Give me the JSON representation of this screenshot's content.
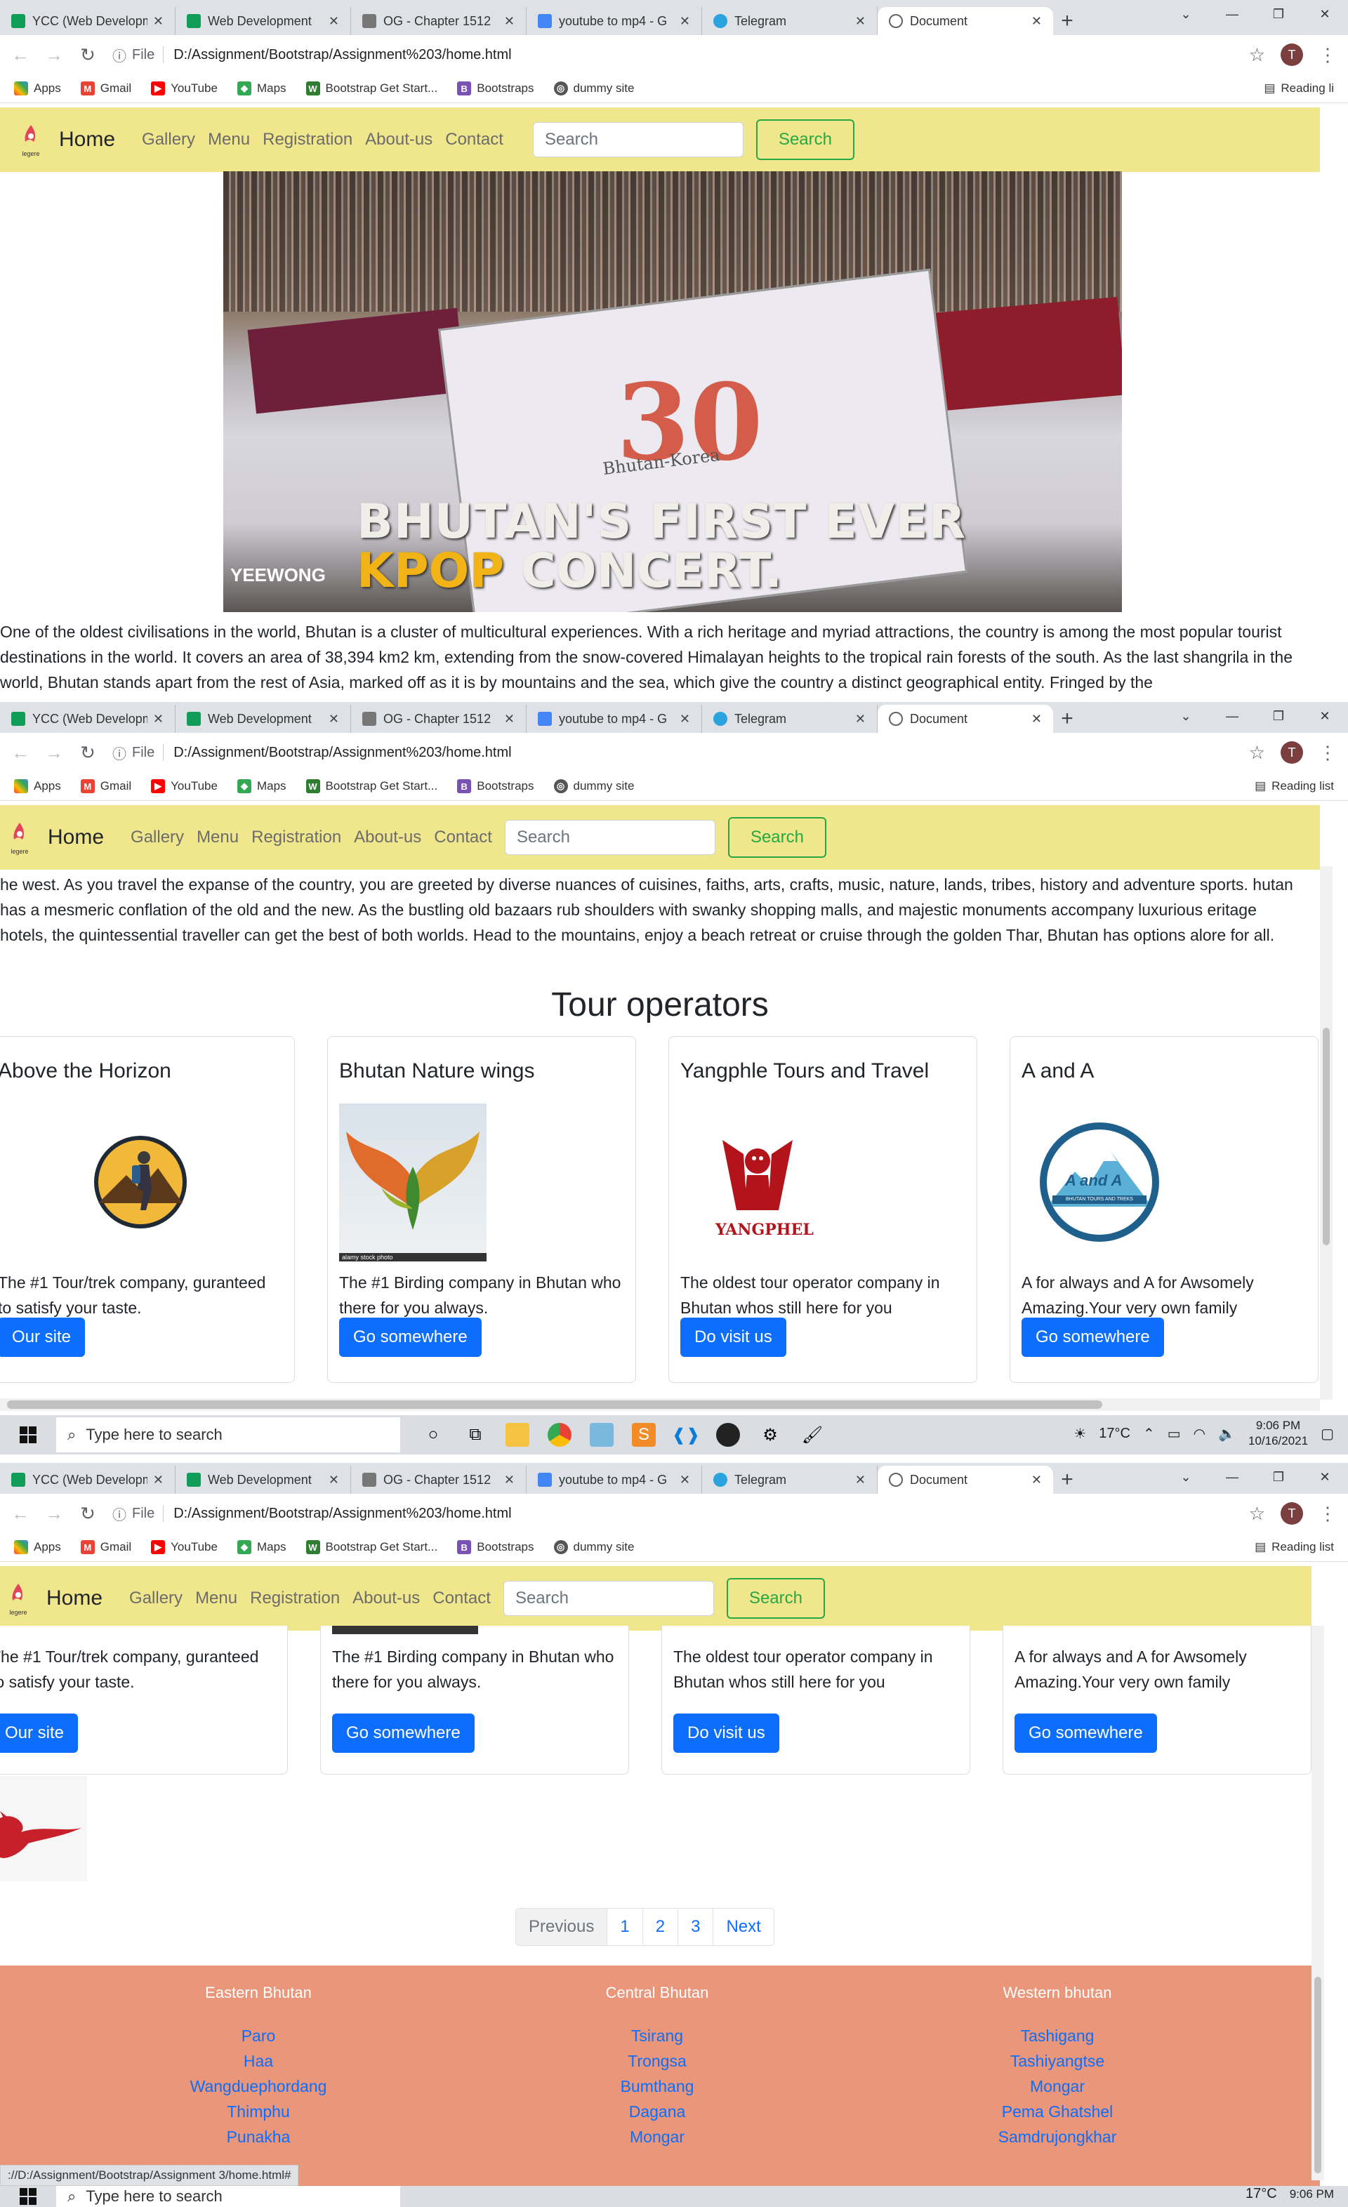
{
  "browser": {
    "tabs": [
      {
        "title": "YCC (Web Developm",
        "icon": "sheets-icon",
        "color": "#0f9d58"
      },
      {
        "title": "Web Development",
        "icon": "sheets-icon",
        "color": "#0f9d58"
      },
      {
        "title": "OG - Chapter 1512",
        "icon": "manga-icon",
        "color": "#555555"
      },
      {
        "title": "youtube to mp4 - G",
        "icon": "google-icon",
        "color": "#4285f4"
      },
      {
        "title": "Telegram",
        "icon": "telegram-icon",
        "color": "#2aa3df"
      },
      {
        "title": "Document",
        "icon": "globe-icon",
        "color": "#5f6368"
      }
    ],
    "address_prefix": "File",
    "address": "D:/Assignment/Bootstrap/Assignment%203/home.html",
    "profile_initial": "T",
    "bookmarks": [
      {
        "label": "Apps",
        "icon": "apps-grid-icon",
        "color": "#ea4335"
      },
      {
        "label": "Gmail",
        "icon": "gmail-icon",
        "color": "#ea4335"
      },
      {
        "label": "YouTube",
        "icon": "youtube-icon",
        "color": "#ff0000"
      },
      {
        "label": "Maps",
        "icon": "maps-icon",
        "color": "#34a853"
      },
      {
        "label": "Bootstrap Get Start...",
        "icon": "w-icon",
        "color": "#2e7d32"
      },
      {
        "label": "Bootstraps",
        "icon": "bootstrap-icon",
        "color": "#7952b3"
      },
      {
        "label": "dummy site",
        "icon": "globe-icon",
        "color": "#555555"
      }
    ],
    "reading_list": "Reading list",
    "reading_list_truncated": "Reading li"
  },
  "navbar": {
    "brand": "Home",
    "logo_text": "legere",
    "links": [
      "Gallery",
      "Menu",
      "Registration",
      "About-us",
      "Contact"
    ],
    "search_placeholder": "Search",
    "search_button": "Search",
    "bg_color": "#f0e68c"
  },
  "hero": {
    "line1": "BHUTAN'S FIRST EVER",
    "line2a": "KPOP",
    "line2b": " CONCERT.",
    "watermark": "YEEWONG",
    "banner_text": "Bhutan-Korea",
    "banner_number": "30"
  },
  "intro": {
    "part1": "One of the oldest civilisations in the world, Bhutan is a cluster of multicultural experiences. With a rich heritage and myriad attractions, the country is among the most popular tourist destinations in the world. It covers an area of 38,394 km2 km, extending from the snow-covered Himalayan heights to the tropical rain forests of the south. As the last shangrila in the world, Bhutan stands apart from the rest of Asia, marked off as it is by mountains and the sea, which give the country a distinct geographical entity. Fringed by the",
    "part2": "he west. As you travel the expanse of the country, you are greeted by diverse nuances of cuisines, faiths, arts, crafts, music, nature, lands, tribes, history and adventure sports. hutan has a mesmeric conflation of the old and the new. As the bustling old bazaars rub shoulders with swanky shopping malls, and majestic monuments accompany luxurious eritage hotels, the quintessential traveller can get the best of both worlds. Head to the mountains, enjoy a beach retreat or cruise through the golden Thar, Bhutan has options alore for all."
  },
  "tour_heading": "Tour operators",
  "cards": [
    {
      "title": "Above the Horizon",
      "text": "The #1 Tour/trek company, guranteed to satisfy your taste.",
      "button": "Our site",
      "image": "hiker-logo"
    },
    {
      "title": "Bhutan Nature wings",
      "text": "The #1 Birding company in Bhutan who there for you always.",
      "button": "Go somewhere",
      "image": "leaf-bird",
      "image_caption": "alamy stock photo"
    },
    {
      "title": "Yangphle Tours and Travel",
      "text": "The oldest tour operator company in Bhutan whos still here for you",
      "button": "Do visit us",
      "image": "yangphel-logo",
      "logo_text": "YANGPHEL"
    },
    {
      "title": "A and A",
      "text": "A for always and A for Awsomely Amazing.Your very own family",
      "button": "Go somewhere",
      "image": "aanda-logo",
      "logo_text": "A and A",
      "logo_sub": "BHUTAN TOURS AND TREKS"
    }
  ],
  "taskbar": {
    "search_placeholder": "Type here to search",
    "temperature": "17°C",
    "time": "9:06 PM",
    "date": "10/16/2021"
  },
  "pagination": {
    "previous": "Previous",
    "pages": [
      "1",
      "2",
      "3"
    ],
    "next": "Next"
  },
  "footer": {
    "bg_color": "#e9967a",
    "columns": [
      {
        "heading": "Eastern Bhutan",
        "links": [
          "Paro",
          "Haa",
          "Wangduephordang",
          "Thimphu",
          "Punakha"
        ]
      },
      {
        "heading": "Central Bhutan",
        "links": [
          "Tsirang",
          "Trongsa",
          "Bumthang",
          "Dagana",
          "Mongar"
        ]
      },
      {
        "heading": "Western bhutan",
        "links": [
          "Tashigang",
          "Tashiyangtse",
          "Mongar",
          "Pema Ghatshel",
          "Samdrujongkhar"
        ]
      }
    ]
  },
  "status_url": "://D:/Assignment/Bootstrap/Assignment 3/home.html#"
}
